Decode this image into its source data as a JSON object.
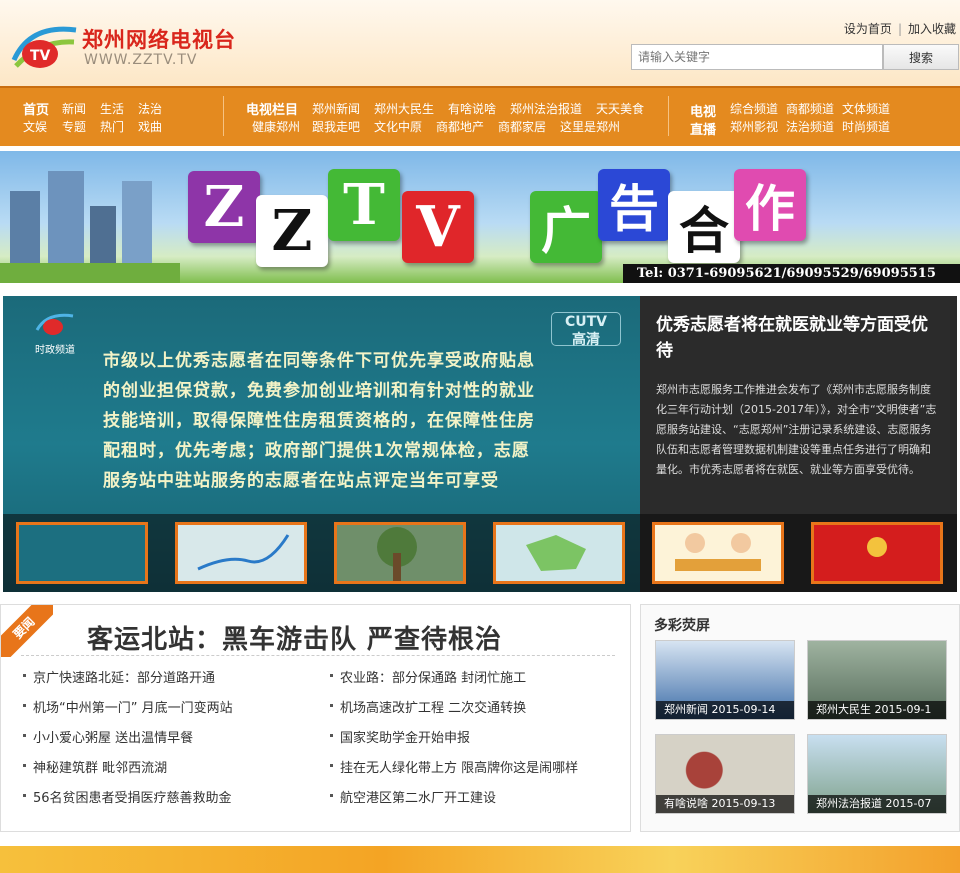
{
  "header": {
    "title": "郑州网络电视台",
    "url": "WWW.ZZTV.TV",
    "logo_text": "TV",
    "set_home": "设为首页",
    "separator": "|",
    "add_favorite": "加入收藏",
    "search_placeholder": "请输入关键字",
    "search_button": "搜索"
  },
  "nav": {
    "group1": [
      "首页",
      "新闻",
      "生活",
      "法治",
      "文娱",
      "专题",
      "热门",
      "戏曲"
    ],
    "group2_title": "电视栏目",
    "group2_row1": [
      "郑州新闻",
      "郑州大民生",
      "有啥说啥",
      "郑州法治报道",
      "天天美食"
    ],
    "group2_row2": [
      "健康郑州",
      "跟我走吧",
      "文化中原",
      "商都地产",
      "商都家居",
      "这里是郑州"
    ],
    "group3_title_top": "电视",
    "group3_title_bottom": "直播",
    "group3_row1": [
      "综合频道",
      "商都频道",
      "文体频道"
    ],
    "group3_row2": [
      "郑州影视",
      "法治频道",
      "时尚频道"
    ]
  },
  "banner": {
    "letters": [
      "Z",
      "Z",
      "T",
      "V"
    ],
    "words": [
      "广",
      "告",
      "合",
      "作"
    ],
    "tel": "Tel: 0371-69095621/69095529/69095515"
  },
  "feature": {
    "video_text": "市级以上优秀志愿者在同等条件下可优先享受政府贴息的创业担保贷款，免费参加创业培训和有针对性的就业技能培训，取得保障性住房租赁资格的，在保障性住房配租时，优先考虑；政府部门提供1次常规体检，志愿服务站中驻站服务的志愿者在站点评定当年可享受",
    "channel_label": "时政频道",
    "cutv_top": "CUTV",
    "cutv_bottom": "高清",
    "headline": "优秀志愿者将在就医就业等方面受优待",
    "summary": "郑州市志愿服务工作推进会发布了《郑州市志愿服务制度化三年行动计划（2015-2017年）》，对全市“文明使者”志愿服务站建设、“志愿郑州”注册记录系统建设、志愿服务队伍和志愿者管理数据机制建设等重点任务进行了明确和量化。市优秀志愿者将在就医、就业等方面享受优待。"
  },
  "news": {
    "tag": "要闻",
    "headline": "客运北站：黑车游击队 严查待根治",
    "left": [
      "京广快速路北延：部分道路开通",
      "机场“中州第一门” 月底一门变两站",
      "小小爱心粥屋 送出温情早餐",
      "神秘建筑群 毗邻西流湖",
      "56名贫困患者受捐医疗慈善救助金"
    ],
    "right": [
      "农业路：部分保通路 封闭忙施工",
      "机场高速改扩工程 二次交通转换",
      "国家奖助学金开始申报",
      "挂在无人绿化带上方 限高牌你这是闹哪样",
      "航空港区第二水厂开工建设"
    ]
  },
  "panel": {
    "title": "多彩荧屏",
    "items": [
      {
        "caption": "郑州新闻 2015-09-14"
      },
      {
        "caption": "郑州大民生 2015-09-1"
      },
      {
        "caption": "有啥说啥 2015-09-13"
      },
      {
        "caption": "郑州法治报道 2015-07"
      }
    ]
  }
}
